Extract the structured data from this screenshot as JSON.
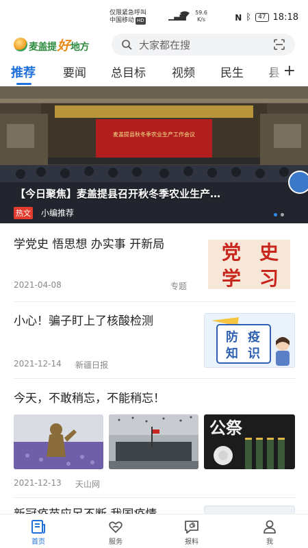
{
  "status_bar": {
    "line1": "仅限紧急呼叫",
    "line2": "中国移动",
    "hd": "HD",
    "signal": "⁴⁶",
    "speed_value": "59.6",
    "speed_unit": "K/s",
    "battery": "47",
    "time": "18:18"
  },
  "header": {
    "logo_part1": "麦盖提",
    "logo_part2": "好",
    "logo_part3": "地方",
    "search_placeholder": "大家都在搜"
  },
  "tabs": [
    {
      "label": "推荐",
      "active": true
    },
    {
      "label": "要闻"
    },
    {
      "label": "总目标"
    },
    {
      "label": "视频"
    },
    {
      "label": "民生"
    },
    {
      "label": "县"
    }
  ],
  "hero": {
    "banner_text": "麦盖提县秋冬季农业生产工作会议",
    "title": "【今日聚焦】麦盖提县召开秋冬季农业生产…",
    "tag": "热文",
    "source": "小编推荐",
    "slide_index": 1,
    "slide_count": 2
  },
  "feed": [
    {
      "title": "学党史 悟思想 办实事 开新局",
      "date": "2021-04-08",
      "source": "专题",
      "thumb_text": [
        "党",
        "史",
        "学",
        "习"
      ]
    },
    {
      "title": "小心！骗子盯上了核酸检测",
      "date": "2021-12-14",
      "source": "新疆日报",
      "thumb_text": [
        "防",
        "疫",
        "知",
        "识"
      ]
    },
    {
      "title": "今天，不敢稍忘，不能稍忘！",
      "date": "2021-12-13",
      "source": "天山网",
      "thumb3_text": "公祭"
    },
    {
      "title": "新冠疫苗应另不断 我国疫情"
    }
  ],
  "bottom_nav": [
    {
      "label": "首页",
      "active": true
    },
    {
      "label": "服务"
    },
    {
      "label": "报料"
    },
    {
      "label": "我"
    }
  ],
  "colors": {
    "accent": "#1e6fd9",
    "hot_tag": "#e33b2e",
    "party_red": "#c8251d"
  }
}
